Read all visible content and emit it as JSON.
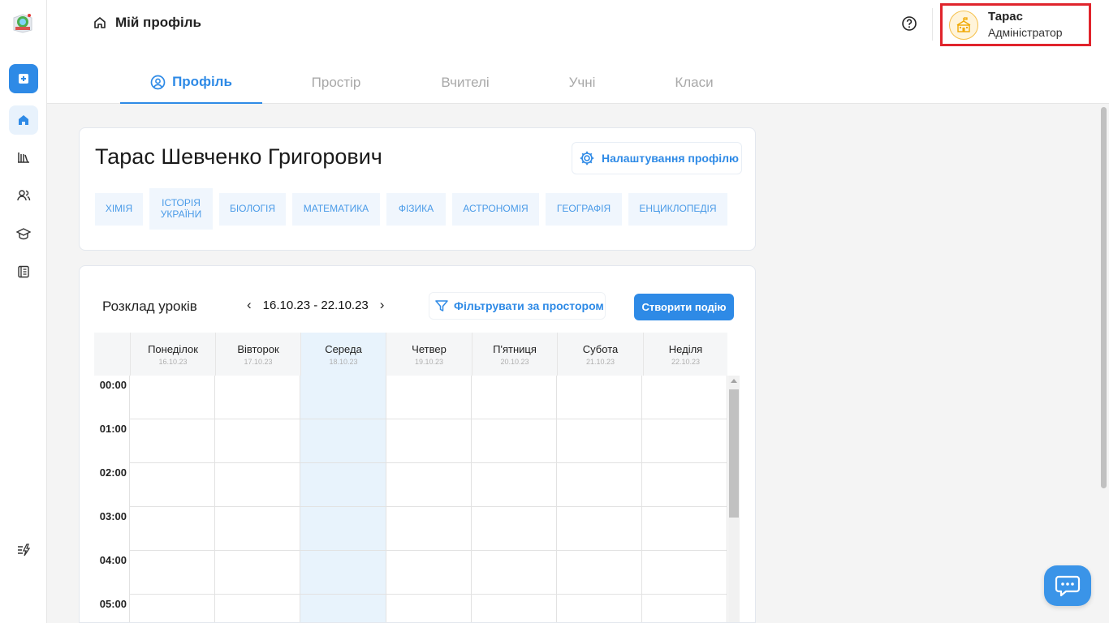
{
  "header": {
    "breadcrumb": "Мій профіль",
    "user": {
      "name": "Тарас",
      "role": "Адміністратор"
    }
  },
  "tabs": [
    {
      "label": "Профіль",
      "active": true
    },
    {
      "label": "Простір",
      "active": false
    },
    {
      "label": "Вчителі",
      "active": false
    },
    {
      "label": "Учні",
      "active": false
    },
    {
      "label": "Класи",
      "active": false
    }
  ],
  "sidebar": {
    "items": [
      "plus-icon",
      "home-icon",
      "library-icon",
      "users-icon",
      "graduation-cap-icon",
      "journal-icon",
      "bolt-list-icon"
    ]
  },
  "profile": {
    "full_name": "Тарас Шевченко Григорович",
    "settings_label": "Налаштування профілю",
    "subjects": [
      "ХІМІЯ",
      "ІСТОРІЯ УКРАЇНИ",
      "БІОЛОГІЯ",
      "МАТЕМАТИКА",
      "ФІЗИКА",
      "АСТРОНОМІЯ",
      "ГЕОГРАФІЯ",
      "ЕНЦИКЛОПЕДІЯ"
    ]
  },
  "schedule": {
    "title": "Розклад уроків",
    "week_range": "16.10.23 - 22.10.23",
    "prev_label": "‹",
    "next_label": "›",
    "filter_label": "Фільтрувати за простором",
    "create_label": "Створити подію",
    "days": [
      {
        "name": "Понеділок",
        "date": "16.10.23"
      },
      {
        "name": "Вівторок",
        "date": "17.10.23"
      },
      {
        "name": "Середа",
        "date": "18.10.23",
        "today": true
      },
      {
        "name": "Четвер",
        "date": "19.10.23"
      },
      {
        "name": "П'ятниця",
        "date": "20.10.23"
      },
      {
        "name": "Субота",
        "date": "21.10.23"
      },
      {
        "name": "Неділя",
        "date": "22.10.23"
      }
    ],
    "hours": [
      "00:00",
      "01:00",
      "02:00",
      "03:00",
      "04:00",
      "05:00"
    ]
  },
  "colors": {
    "accent": "#2e8ae6",
    "today_bg": "#e8f3fc",
    "highlight_border": "#e0242c"
  }
}
